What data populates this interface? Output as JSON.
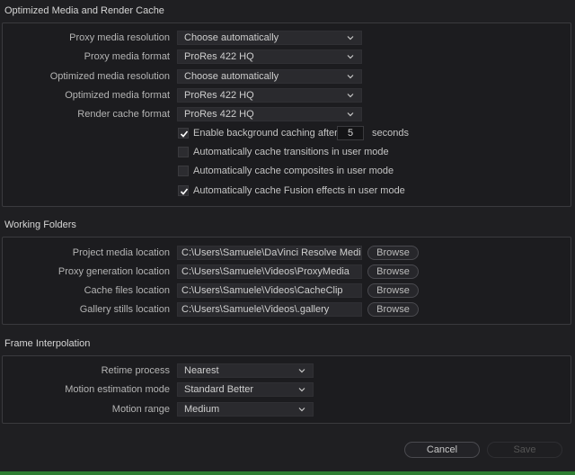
{
  "sections": {
    "optimized": {
      "title": "Optimized Media and Render Cache",
      "rows": [
        {
          "label": "Proxy media resolution",
          "value": "Choose automatically"
        },
        {
          "label": "Proxy media format",
          "value": "ProRes 422 HQ"
        },
        {
          "label": "Optimized media resolution",
          "value": "Choose automatically"
        },
        {
          "label": "Optimized media format",
          "value": "ProRes 422 HQ"
        },
        {
          "label": "Render cache format",
          "value": "ProRes 422 HQ"
        }
      ],
      "background_cache": {
        "label": "Enable background caching after",
        "seconds": "5",
        "unit": "seconds",
        "checked": true
      },
      "checkboxes": [
        {
          "label": "Automatically cache transitions in user mode",
          "checked": false
        },
        {
          "label": "Automatically cache composites in user mode",
          "checked": false
        },
        {
          "label": "Automatically cache Fusion effects in user mode",
          "checked": true
        }
      ]
    },
    "working_folders": {
      "title": "Working Folders",
      "browse_label": "Browse",
      "rows": [
        {
          "label": "Project media location",
          "value": "C:\\Users\\Samuele\\DaVinci Resolve Media"
        },
        {
          "label": "Proxy generation location",
          "value": "C:\\Users\\Samuele\\Videos\\ProxyMedia"
        },
        {
          "label": "Cache files location",
          "value": "C:\\Users\\Samuele\\Videos\\CacheClip"
        },
        {
          "label": "Gallery stills location",
          "value": "C:\\Users\\Samuele\\Videos\\.gallery"
        }
      ]
    },
    "frame_interpolation": {
      "title": "Frame Interpolation",
      "rows": [
        {
          "label": "Retime process",
          "value": "Nearest"
        },
        {
          "label": "Motion estimation mode",
          "value": "Standard Better"
        },
        {
          "label": "Motion range",
          "value": "Medium"
        }
      ]
    }
  },
  "footer": {
    "cancel_label": "Cancel",
    "save_label": "Save"
  },
  "colors": {
    "background": "#1f1f22",
    "accent_strip": "#2e7d32",
    "disabled_text": "#555555"
  }
}
